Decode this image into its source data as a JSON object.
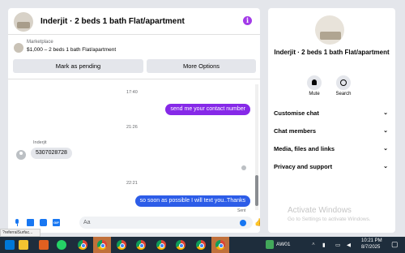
{
  "chat": {
    "title": "Inderjit · 2 beds 1 bath Flat/apartment",
    "marketplace_label": "Marketplace",
    "listing": "$1,000 – 2 beds 1 bath Flat/apartment",
    "mark_pending_label": "Mark as pending",
    "more_options_label": "More Options",
    "messages": [
      {
        "type": "time",
        "text": "17:40"
      },
      {
        "type": "out",
        "text": "send me your contact number",
        "color": "#8629e8"
      },
      {
        "type": "time",
        "text": "21:26"
      },
      {
        "type": "sender",
        "text": "Inderjit"
      },
      {
        "type": "in",
        "text": "5307028728"
      },
      {
        "type": "time",
        "text": "22:21"
      },
      {
        "type": "out",
        "text": "so soon as possible I will text you..Thanks",
        "color": "#2d5de8"
      },
      {
        "type": "status",
        "text": "Sent"
      }
    ],
    "composer_placeholder": "Aa"
  },
  "info": {
    "name": "Inderjit · 2 beds 1 bath Flat/apartment",
    "mute_label": "Mute",
    "search_label": "Search",
    "sections": [
      "Customise chat",
      "Chat members",
      "Media, files and links",
      "Privacy and support"
    ],
    "watermark_title": "Activate Windows",
    "watermark_sub": "Go to Settings to activate Windows."
  },
  "statusbar": {
    "url": "?referralSurfac..."
  },
  "taskbar": {
    "tray_label": "AW01",
    "time": "10:21 PM",
    "date": "8/7/2025"
  },
  "colors": {
    "accent_purple": "#8629e8",
    "accent_blue": "#1877f2",
    "taskbar": "#1e2d3c"
  }
}
